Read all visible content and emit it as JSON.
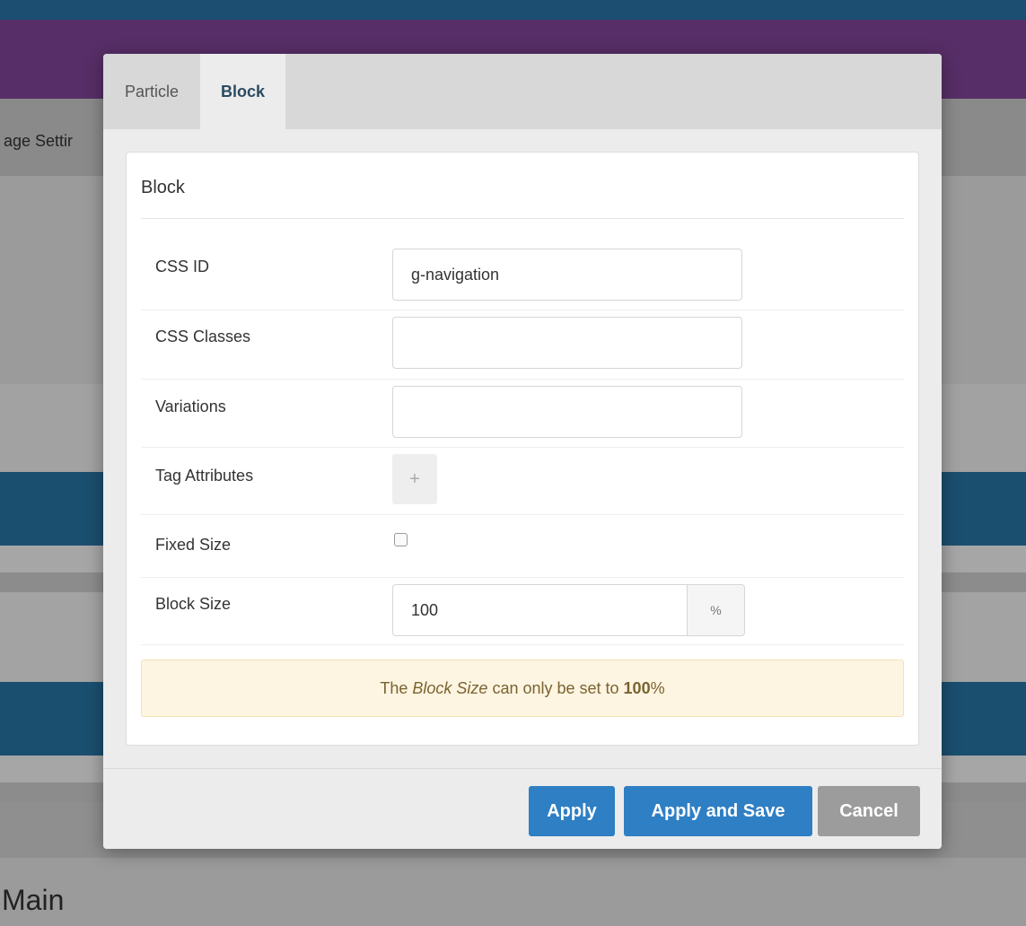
{
  "background": {
    "settings_label": "age Settir",
    "main_label": "Main"
  },
  "modal": {
    "tabs": [
      {
        "label": "Particle",
        "active": false
      },
      {
        "label": "Block",
        "active": true
      }
    ],
    "section_title": "Block",
    "fields": {
      "css_id": {
        "label": "CSS ID",
        "value": "g-navigation"
      },
      "css_classes": {
        "label": "CSS Classes",
        "value": ""
      },
      "variations": {
        "label": "Variations",
        "value": ""
      },
      "tag_attributes": {
        "label": "Tag Attributes",
        "add_glyph": "+"
      },
      "fixed_size": {
        "label": "Fixed Size",
        "checked": false
      },
      "block_size": {
        "label": "Block Size",
        "value": "100",
        "unit": "%"
      }
    },
    "notice": {
      "prefix": "The",
      "emphasis": "Block Size",
      "middle": "can only be set to",
      "strong": "100",
      "suffix": "%"
    },
    "buttons": {
      "apply": "Apply",
      "apply_and_save": "Apply and Save",
      "cancel": "Cancel"
    }
  },
  "colors": {
    "primary_button": "#2f7fc4",
    "cancel_button": "#9c9c9c",
    "header_purple": "#572e67",
    "header_blue": "#1b4e70",
    "notice_bg": "#fdf5e1"
  },
  "icons": {
    "add": "plus-icon"
  }
}
